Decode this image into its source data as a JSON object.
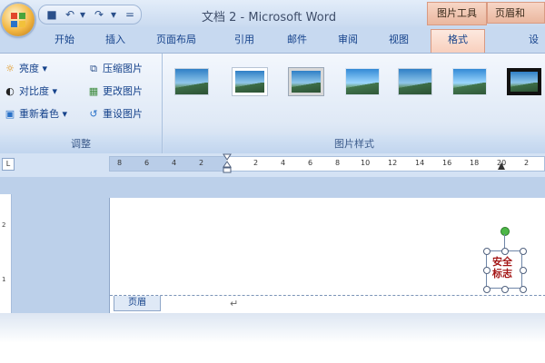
{
  "window": {
    "title": "文档 2 - Microsoft Word",
    "context_tab_picture_tools": "图片工具",
    "context_tab_header_footer": "页眉和"
  },
  "quick_access": {
    "save_icon": "save-icon",
    "undo_icon": "undo-icon",
    "redo_icon": "redo-icon",
    "more": "="
  },
  "tabs": [
    {
      "label": "开始"
    },
    {
      "label": "插入"
    },
    {
      "label": "页面布局"
    },
    {
      "label": "引用"
    },
    {
      "label": "邮件"
    },
    {
      "label": "审阅"
    },
    {
      "label": "视图"
    },
    {
      "label": "格式",
      "active": true
    },
    {
      "label": "设"
    }
  ],
  "ribbon": {
    "adjust_group": {
      "label": "调整",
      "brightness": "亮度",
      "contrast": "对比度",
      "recolor": "重新着色",
      "compress": "压缩图片",
      "change": "更改图片",
      "reset": "重设图片"
    },
    "styles_group": {
      "label": "图片样式"
    }
  },
  "ruler": {
    "corner": "L",
    "ticks": [
      "8",
      "6",
      "4",
      "2",
      "2",
      "4",
      "6",
      "8",
      "10",
      "12",
      "14",
      "16",
      "18",
      "20",
      "2"
    ],
    "vertical_ticks": [
      "2",
      "1"
    ]
  },
  "document": {
    "header_tag": "页眉",
    "para_mark": "↵",
    "sign_text_line1": "安全",
    "sign_text_line2": "标志"
  },
  "colors": {
    "ribbon_blue": "#15428b",
    "context_orange": "#eab79f",
    "sign_red": "#a31515"
  }
}
